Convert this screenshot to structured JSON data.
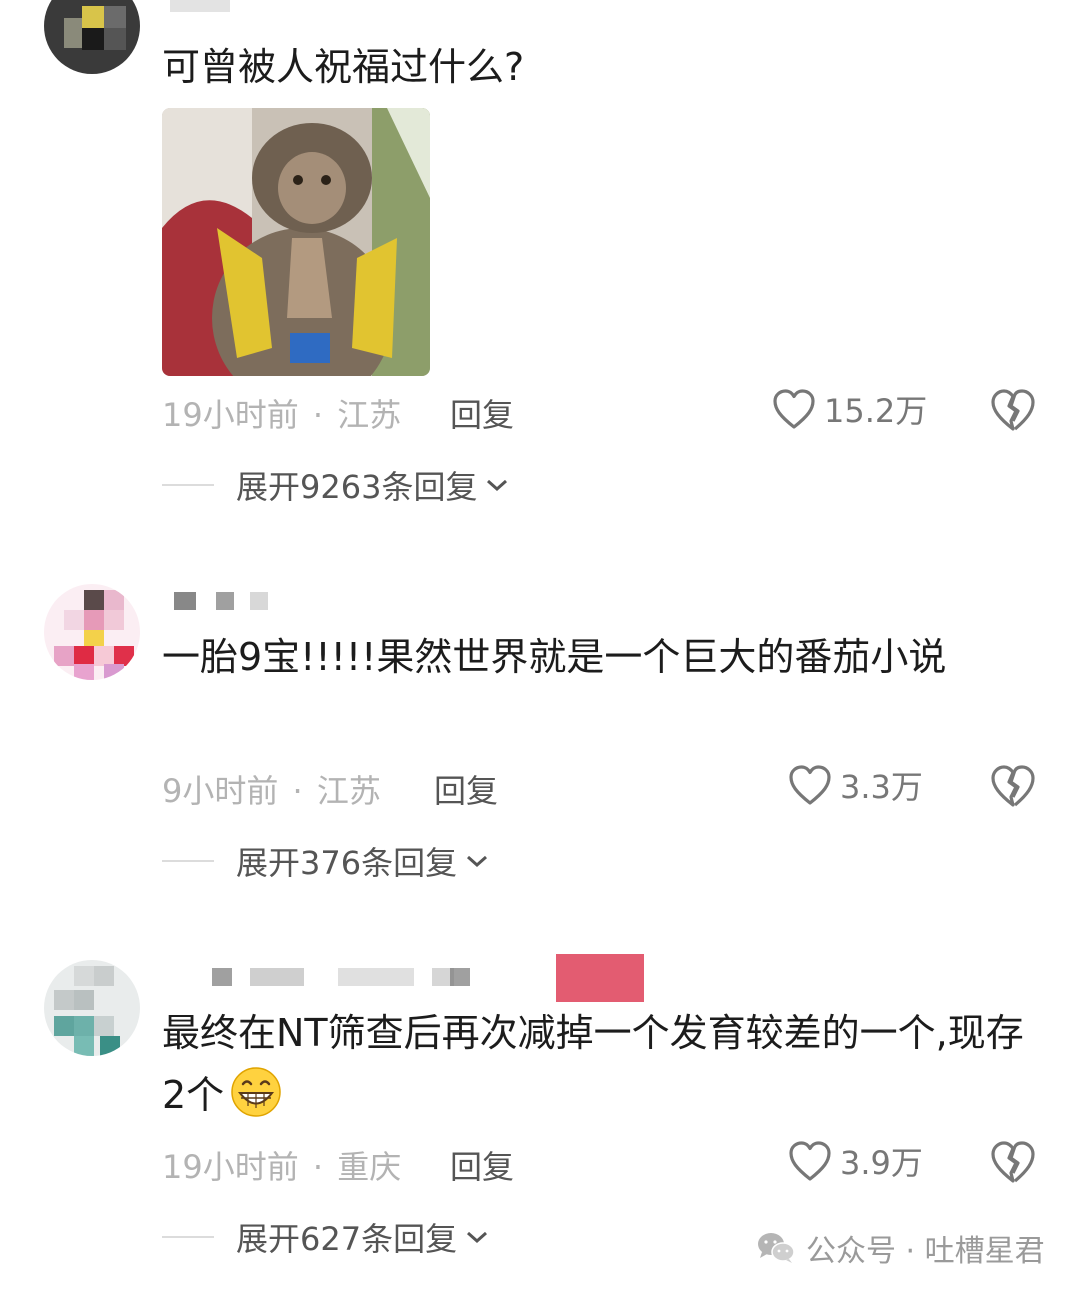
{
  "comments": [
    {
      "text": "可曾被人祝福过什么?",
      "time": "19小时前",
      "location": "江苏",
      "reply_label": "回复",
      "likes": "15.2万",
      "expand_label": "展开9263条回复",
      "sticker_icon": "praying-monkey-sticker"
    },
    {
      "text": "一胎9宝!!!!!果然世界就是一个巨大的番茄小说",
      "time": "9小时前",
      "location": "江苏",
      "reply_label": "回复",
      "likes": "3.3万",
      "expand_label": "展开376条回复"
    },
    {
      "text": "最终在NT筛查后再次减掉一个发育较差的一个,现存2个",
      "emoji_icon": "grinning-face-emoji",
      "time": "19小时前",
      "location": "重庆",
      "reply_label": "回复",
      "likes": "3.9万",
      "expand_label": "展开627条回复"
    }
  ],
  "meta_separator": "·",
  "watermark": {
    "text": "公众号 · 吐槽星君",
    "icon": "wechat-icon"
  },
  "colors": {
    "text": "#1c1c1c",
    "meta": "#b3b3b3",
    "action": "#555555"
  }
}
